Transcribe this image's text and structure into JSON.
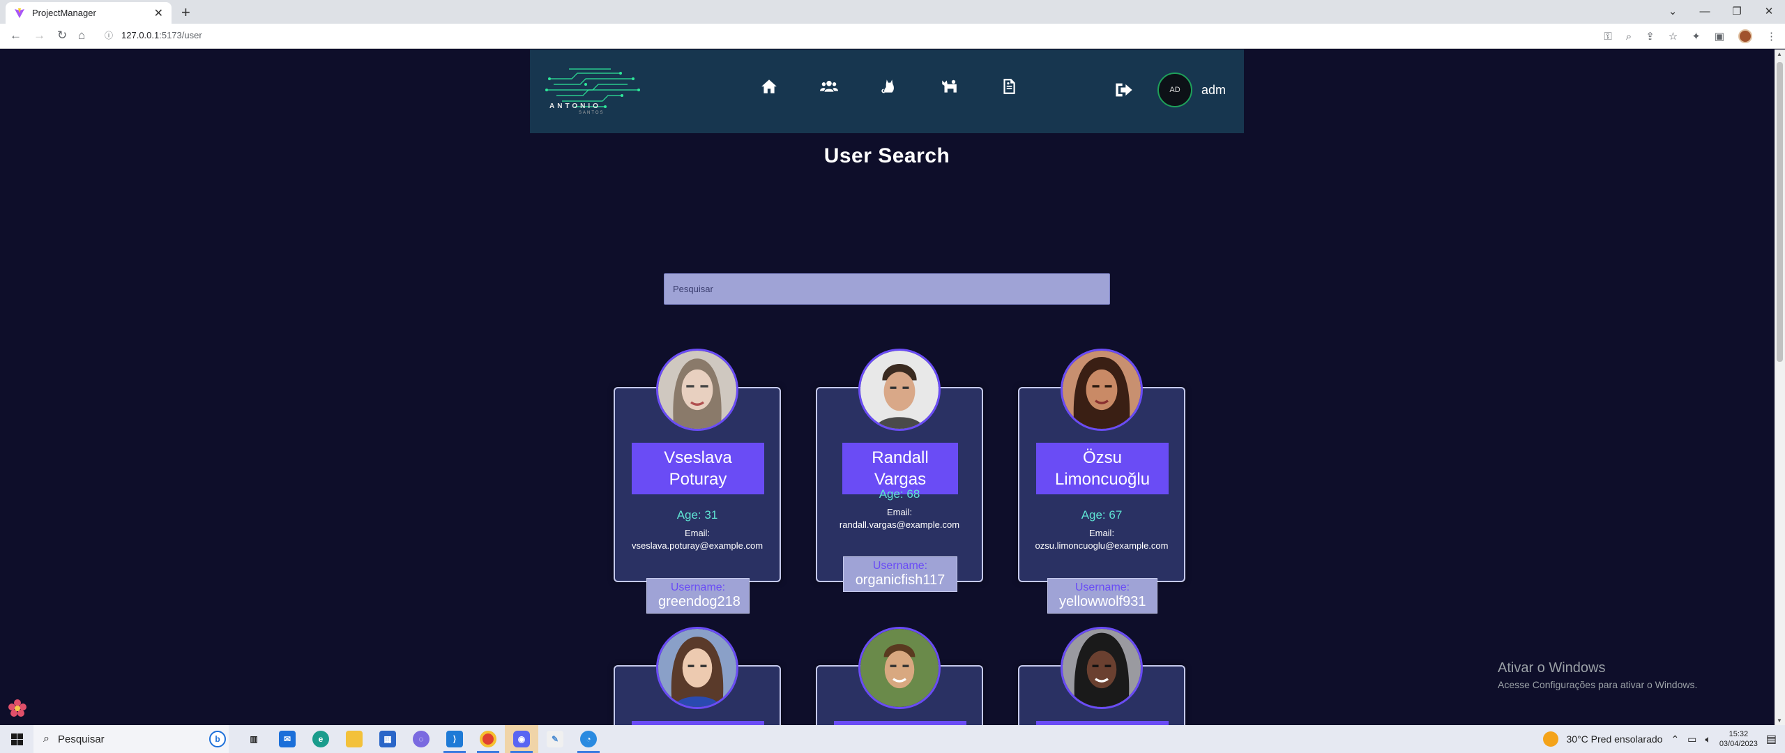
{
  "browser": {
    "tab_title": "ProjectManager",
    "url_host": "127.0.0.1",
    "url_path": ":5173/user",
    "new_tab": "+",
    "tab_close": "✕"
  },
  "app": {
    "logo_text": "ANTONIO",
    "logo_sub": "SANTOS",
    "avatar_initials": "AD",
    "user_name": "adm",
    "page_title": "User Search",
    "search_placeholder": "Pesquisar",
    "nav_icons": [
      "home-icon",
      "users-icon",
      "cat-icon",
      "pets-icon",
      "report-icon"
    ]
  },
  "users": [
    {
      "name_line1": "Vseslava",
      "name_line2": "Poturay",
      "age": "Age: 31",
      "email_label": "Email:",
      "email": "vseslava.poturay@example.com",
      "username_label": "Username:",
      "username": "greendog218"
    },
    {
      "name_line1": "Randall Vargas",
      "name_line2": "",
      "age": "Age: 68",
      "email_label": "Email:",
      "email": "randall.vargas@example.com",
      "username_label": "Username:",
      "username": "organicfish117"
    },
    {
      "name_line1": "Özsu",
      "name_line2": "Limoncuoğlu",
      "age": "Age: 67",
      "email_label": "Email:",
      "email": "ozsu.limoncuoglu@example.com",
      "username_label": "Username:",
      "username": "yellowwolf931"
    }
  ],
  "windows_activation": {
    "title": "Ativar o Windows",
    "subtitle": "Acesse Configurações para ativar o Windows."
  },
  "taskbar": {
    "search_placeholder": "Pesquisar",
    "weather": "30°C  Pred ensolarado",
    "time": "15:32",
    "date": "03/04/2023"
  },
  "colors": {
    "page_bg": "#0e0e2a",
    "navbar_bg": "#17364f",
    "card_bg": "#2a3163",
    "accent_purple": "#6a4cf5",
    "age_teal": "#5fe3d3",
    "search_bg": "#9fa3d6"
  }
}
